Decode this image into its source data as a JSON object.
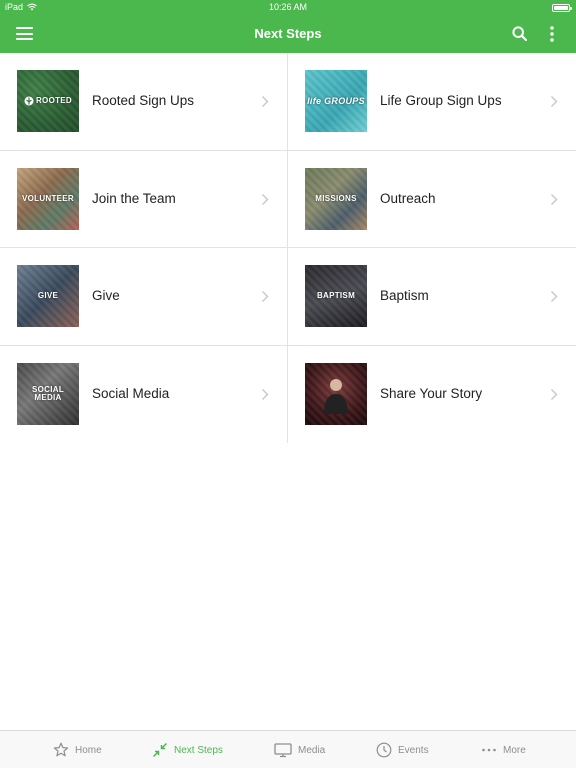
{
  "status_bar": {
    "device": "iPad",
    "time": "10:26 AM"
  },
  "nav": {
    "title": "Next Steps",
    "left_icon": "menu-icon",
    "right_icons": [
      "search-icon",
      "more-vertical-icon"
    ]
  },
  "colors": {
    "brand_green": "#4bb84e",
    "tab_inactive": "#8e8e8e"
  },
  "items": [
    {
      "label": "Rooted Sign Ups",
      "thumb_text": "ROOTED",
      "thumb_icon": "rooted-logo-icon"
    },
    {
      "label": "Life Group Sign Ups",
      "thumb_text": "life GROUPS"
    },
    {
      "label": "Join the Team",
      "thumb_text": "VOLUNTEER"
    },
    {
      "label": "Outreach",
      "thumb_text": "MISSIONS"
    },
    {
      "label": "Give",
      "thumb_text": "GIVE"
    },
    {
      "label": "Baptism",
      "thumb_text": "BAPTISM"
    },
    {
      "label": "Social Media",
      "thumb_text": "SOCIAL\nMEDIA"
    },
    {
      "label": "Share Your Story",
      "thumb_text": ""
    }
  ],
  "tabs": [
    {
      "label": "Home",
      "icon": "star-icon",
      "active": false
    },
    {
      "label": "Next Steps",
      "icon": "next-steps-arrows-icon",
      "active": true
    },
    {
      "label": "Media",
      "icon": "monitor-icon",
      "active": false
    },
    {
      "label": "Events",
      "icon": "clock-icon",
      "active": false
    },
    {
      "label": "More",
      "icon": "more-dots-icon",
      "active": false
    }
  ]
}
